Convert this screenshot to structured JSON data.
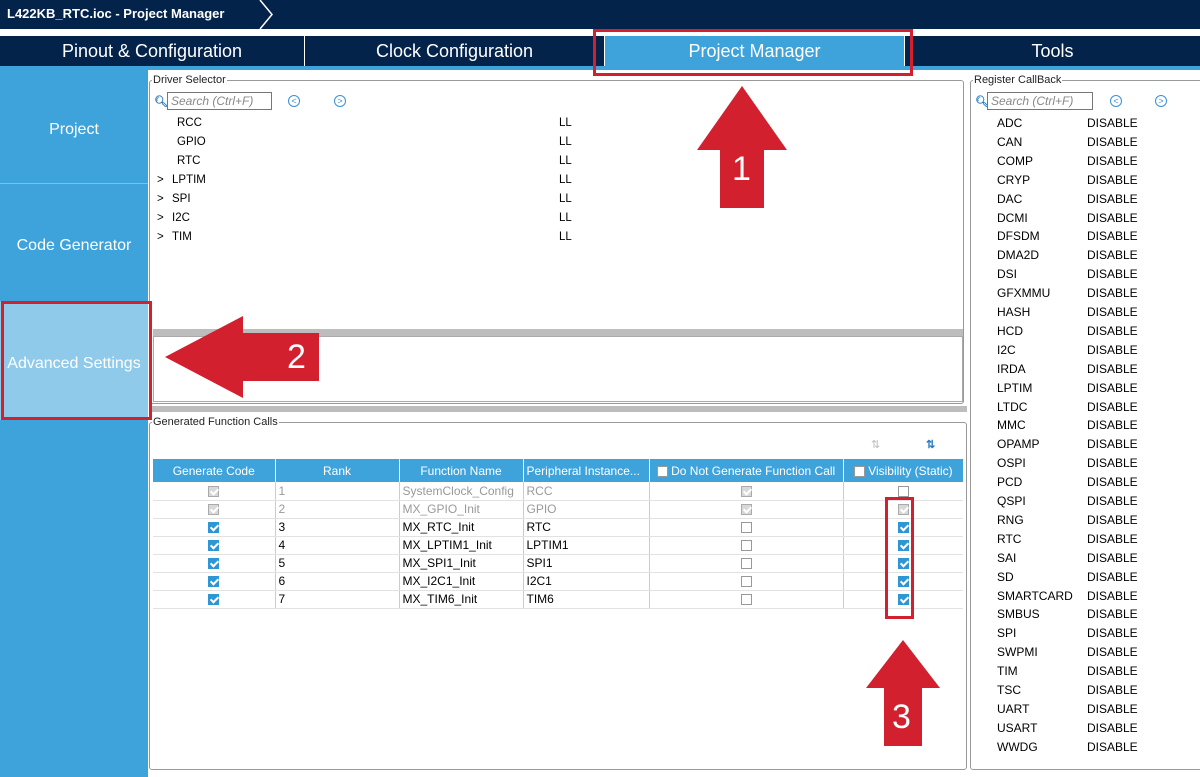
{
  "window": {
    "title": "L422KB_RTC.ioc - Project Manager"
  },
  "tabs": [
    {
      "label": "Pinout & Configuration"
    },
    {
      "label": "Clock Configuration"
    },
    {
      "label": "Project Manager"
    },
    {
      "label": "Tools"
    }
  ],
  "sidebar": {
    "items": [
      {
        "label": "Project"
      },
      {
        "label": "Code Generator"
      },
      {
        "label": "Advanced Settings"
      }
    ]
  },
  "driver_selector": {
    "legend": "Driver Selector",
    "search_placeholder": "Search (Ctrl+F)",
    "rows": [
      {
        "expander": "",
        "name": "RCC",
        "driver": "LL"
      },
      {
        "expander": "",
        "name": "GPIO",
        "driver": "LL"
      },
      {
        "expander": "",
        "name": "RTC",
        "driver": "LL"
      },
      {
        "expander": ">",
        "name": "LPTIM",
        "driver": "LL"
      },
      {
        "expander": ">",
        "name": "SPI",
        "driver": "LL"
      },
      {
        "expander": ">",
        "name": "I2C",
        "driver": "LL"
      },
      {
        "expander": ">",
        "name": "TIM",
        "driver": "LL"
      }
    ]
  },
  "generated_calls": {
    "legend": "Generated Function Calls",
    "headers": [
      "Generate Code",
      "Rank",
      "Function Name",
      "Peripheral Instance...",
      "Do Not Generate Function Call",
      "Visibility (Static)"
    ],
    "rows": [
      {
        "generate": "dim",
        "rank": "1",
        "func": "SystemClock_Config",
        "periph": "RCC",
        "nogen": "dim",
        "vis": "off",
        "grey": true
      },
      {
        "generate": "dim",
        "rank": "2",
        "func": "MX_GPIO_Init",
        "periph": "GPIO",
        "nogen": "dim",
        "vis": "dim",
        "grey": true
      },
      {
        "generate": "on",
        "rank": "3",
        "func": "MX_RTC_Init",
        "periph": "RTC",
        "nogen": "off",
        "vis": "on",
        "grey": false
      },
      {
        "generate": "on",
        "rank": "4",
        "func": "MX_LPTIM1_Init",
        "periph": "LPTIM1",
        "nogen": "off",
        "vis": "on",
        "grey": false
      },
      {
        "generate": "on",
        "rank": "5",
        "func": "MX_SPI1_Init",
        "periph": "SPI1",
        "nogen": "off",
        "vis": "on",
        "grey": false
      },
      {
        "generate": "on",
        "rank": "6",
        "func": "MX_I2C1_Init",
        "periph": "I2C1",
        "nogen": "off",
        "vis": "on",
        "grey": false
      },
      {
        "generate": "on",
        "rank": "7",
        "func": "MX_TIM6_Init",
        "periph": "TIM6",
        "nogen": "off",
        "vis": "on",
        "grey": false
      }
    ]
  },
  "register_callback": {
    "legend": "Register CallBack",
    "search_placeholder": "Search (Ctrl+F)",
    "rows": [
      [
        "ADC",
        "DISABLE"
      ],
      [
        "CAN",
        "DISABLE"
      ],
      [
        "COMP",
        "DISABLE"
      ],
      [
        "CRYP",
        "DISABLE"
      ],
      [
        "DAC",
        "DISABLE"
      ],
      [
        "DCMI",
        "DISABLE"
      ],
      [
        "DFSDM",
        "DISABLE"
      ],
      [
        "DMA2D",
        "DISABLE"
      ],
      [
        "DSI",
        "DISABLE"
      ],
      [
        "GFXMMU",
        "DISABLE"
      ],
      [
        "HASH",
        "DISABLE"
      ],
      [
        "HCD",
        "DISABLE"
      ],
      [
        "I2C",
        "DISABLE"
      ],
      [
        "IRDA",
        "DISABLE"
      ],
      [
        "LPTIM",
        "DISABLE"
      ],
      [
        "LTDC",
        "DISABLE"
      ],
      [
        "MMC",
        "DISABLE"
      ],
      [
        "OPAMP",
        "DISABLE"
      ],
      [
        "OSPI",
        "DISABLE"
      ],
      [
        "PCD",
        "DISABLE"
      ],
      [
        "QSPI",
        "DISABLE"
      ],
      [
        "RNG",
        "DISABLE"
      ],
      [
        "RTC",
        "DISABLE"
      ],
      [
        "SAI",
        "DISABLE"
      ],
      [
        "SD",
        "DISABLE"
      ],
      [
        "SMARTCARD",
        "DISABLE"
      ],
      [
        "SMBUS",
        "DISABLE"
      ],
      [
        "SPI",
        "DISABLE"
      ],
      [
        "SWPMI",
        "DISABLE"
      ],
      [
        "TIM",
        "DISABLE"
      ],
      [
        "TSC",
        "DISABLE"
      ],
      [
        "UART",
        "DISABLE"
      ],
      [
        "USART",
        "DISABLE"
      ],
      [
        "WWDG",
        "DISABLE"
      ]
    ]
  },
  "annotations": {
    "arrow1": "1",
    "arrow2": "2",
    "arrow3": "3"
  },
  "colors": {
    "header": "#03234b",
    "accent": "#3fa3db",
    "annotation": "#d2202f"
  }
}
